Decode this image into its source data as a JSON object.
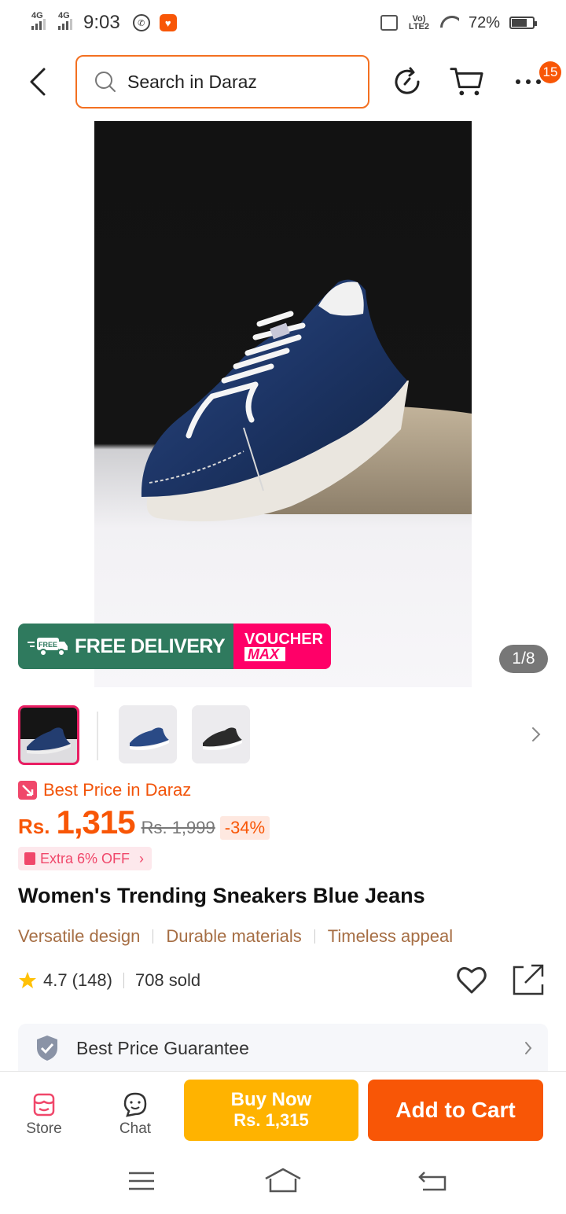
{
  "status_bar": {
    "net1": "4G",
    "net2": "4G",
    "time": "9:03",
    "volte": "Vo) LTE2",
    "battery": "72%",
    "battery_level": 0.72
  },
  "header": {
    "search_placeholder": "Search in Daraz",
    "cart_badge": "15"
  },
  "gallery": {
    "promo_delivery": "FREE DELIVERY",
    "promo_free_tag": "FREE",
    "promo_voucher_line1": "VOUCHER",
    "promo_voucher_line2": "MAX",
    "pager": "1/8"
  },
  "product": {
    "best_price_label": "Best Price in Daraz",
    "currency": "Rs.",
    "price": "1,315",
    "original_price": "Rs. 1,999",
    "discount": "-34%",
    "extra_off": "Extra 6% OFF",
    "title": "Women's Trending Sneakers Blue Jeans",
    "features": [
      "Versatile design",
      "Durable materials",
      "Timeless appeal"
    ],
    "rating": "4.7",
    "reviews": "(148)",
    "sold": "708 sold",
    "guarantee": "Best Price Guarantee"
  },
  "bottom_bar": {
    "store_label": "Store",
    "chat_label": "Chat",
    "buy_now_line1": "Buy Now",
    "buy_now_line2": "Rs. 1,315",
    "add_to_cart": "Add to Cart"
  },
  "colors": {
    "brand_orange": "#f85606",
    "buy_now_yellow": "#ffb300",
    "delivery_green": "#2f7a5e",
    "voucher_pink": "#ff0068"
  }
}
